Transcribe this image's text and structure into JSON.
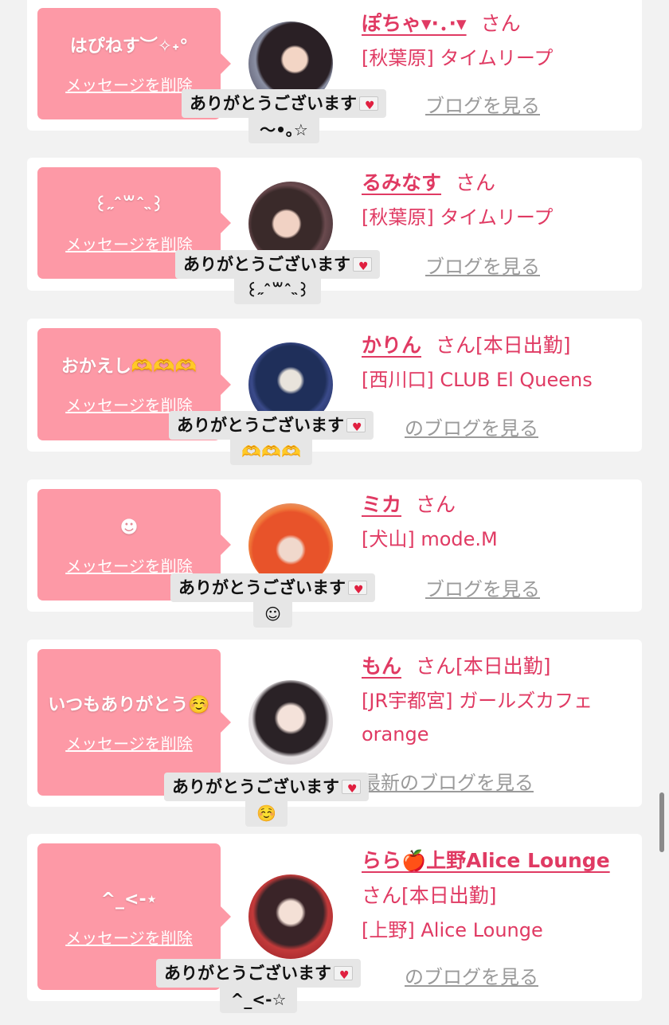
{
  "delete_label": "メッセージを削除",
  "blog_label": "ブログを見る",
  "overlay_text": "ありがとうございます",
  "san": "さん",
  "colors": {
    "accent": "#e03a63",
    "bubble": "#fd99a6",
    "background": "#f2f2f2"
  },
  "entries": [
    {
      "message": "はぴねす︶✧˖°",
      "name": "ぽちゃ▾·．·▾",
      "status": "",
      "shop": "[秋葉原] タイムリープ",
      "blog": "ブログを見る",
      "reply": "〜•｡☆"
    },
    {
      "message": "꒰˶ˆ꒳ˆ˵꒱",
      "name": "るみなす",
      "status": "",
      "shop": "[秋葉原] タイムリープ",
      "blog": "ブログを見る",
      "reply": "꒰˶ˆ꒳ˆ˵꒱"
    },
    {
      "message": "おかえし🫶🫶🫶",
      "name": "かりん",
      "status": "[本日出勤]",
      "shop": "[西川口] CLUB El Queens",
      "blog": "のブログを見る",
      "reply": "🫶🫶🫶"
    },
    {
      "message": "☻",
      "name": "ミカ",
      "status": "",
      "shop": "[犬山] mode.M",
      "blog": "ブログを見る",
      "reply": "☺"
    },
    {
      "message": "いつもありがとう☺️",
      "name": "もん",
      "status": "[本日出勤]",
      "shop": "[JR宇都宮] ガールズカフェ orange",
      "blog": "最新のブログを見る",
      "reply": "☺️"
    },
    {
      "message": "^_<-⋆",
      "name": "らら🍎上野Alice Lounge",
      "status": "[本日出勤]",
      "shop": "[上野] Alice Lounge",
      "blog": "のブログを見る",
      "reply": "^_<-☆"
    }
  ]
}
